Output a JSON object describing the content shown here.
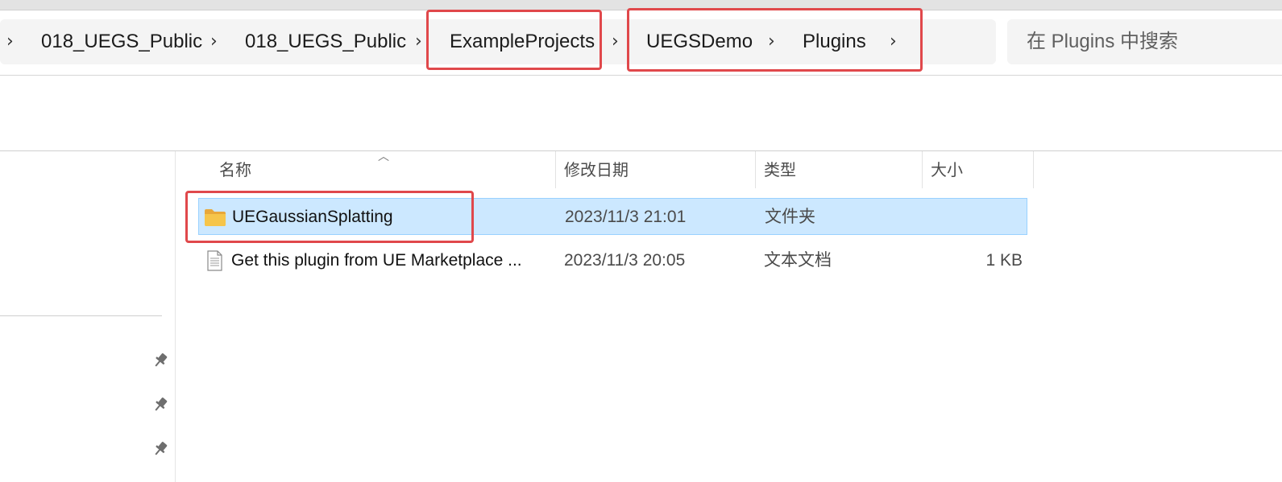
{
  "breadcrumb": {
    "items": [
      "018_UEGS_Public",
      "018_UEGS_Public",
      "ExampleProjects",
      "UEGSDemo",
      "Plugins"
    ],
    "separator": "›"
  },
  "search": {
    "placeholder": "在 Plugins 中搜索"
  },
  "columns": {
    "name": "名称",
    "modified": "修改日期",
    "type": "类型",
    "size": "大小"
  },
  "files": [
    {
      "name": "UEGaussianSplatting",
      "modified": "2023/11/3 21:01",
      "type": "文件夹",
      "size": "",
      "icon": "folder-icon",
      "selected": true
    },
    {
      "name": "Get this plugin from UE Marketplace ...",
      "modified": "2023/11/3 20:05",
      "type": "文本文档",
      "size": "1 KB",
      "icon": "text-document-icon",
      "selected": false
    }
  ],
  "colors": {
    "highlight": "#e0484b",
    "selection": "#cce8ff",
    "selection_border": "#99d1ff",
    "folder": "#f6c54a"
  }
}
